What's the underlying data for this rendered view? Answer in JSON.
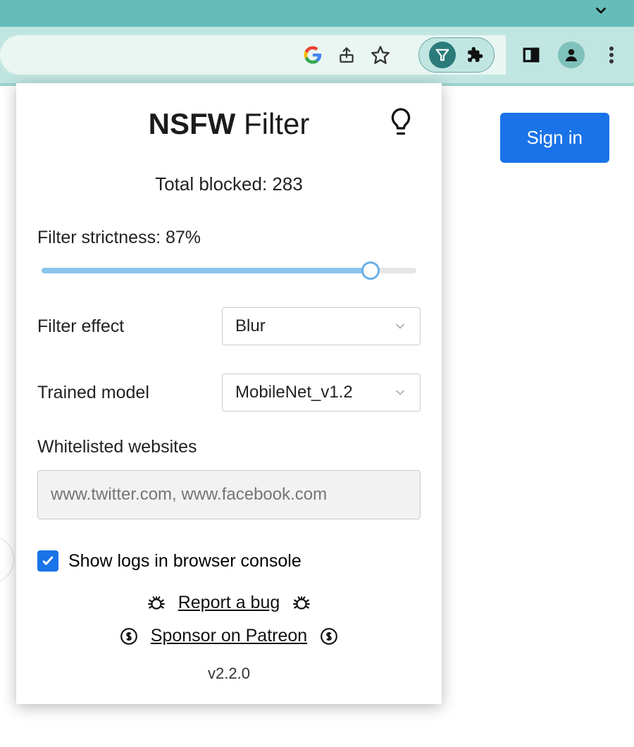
{
  "browser": {
    "sign_in_label": "Sign in"
  },
  "popup": {
    "title_bold": "NSFW",
    "title_light": " Filter",
    "total_blocked_label": "Total blocked: ",
    "total_blocked_value": "283",
    "strictness_label": "Filter strictness: ",
    "strictness_value": "87%",
    "strictness_percent": 87,
    "filter_effect_label": "Filter effect",
    "filter_effect_value": "Blur",
    "trained_model_label": "Trained model",
    "trained_model_value": "MobileNet_v1.2",
    "whitelist_label": "Whitelisted websites",
    "whitelist_placeholder": "www.twitter.com, www.facebook.com",
    "show_logs_label": "Show logs in browser console",
    "show_logs_checked": true,
    "report_bug_label": "Report a bug",
    "sponsor_label": "Sponsor on Patreon",
    "version": "v2.2.0"
  }
}
